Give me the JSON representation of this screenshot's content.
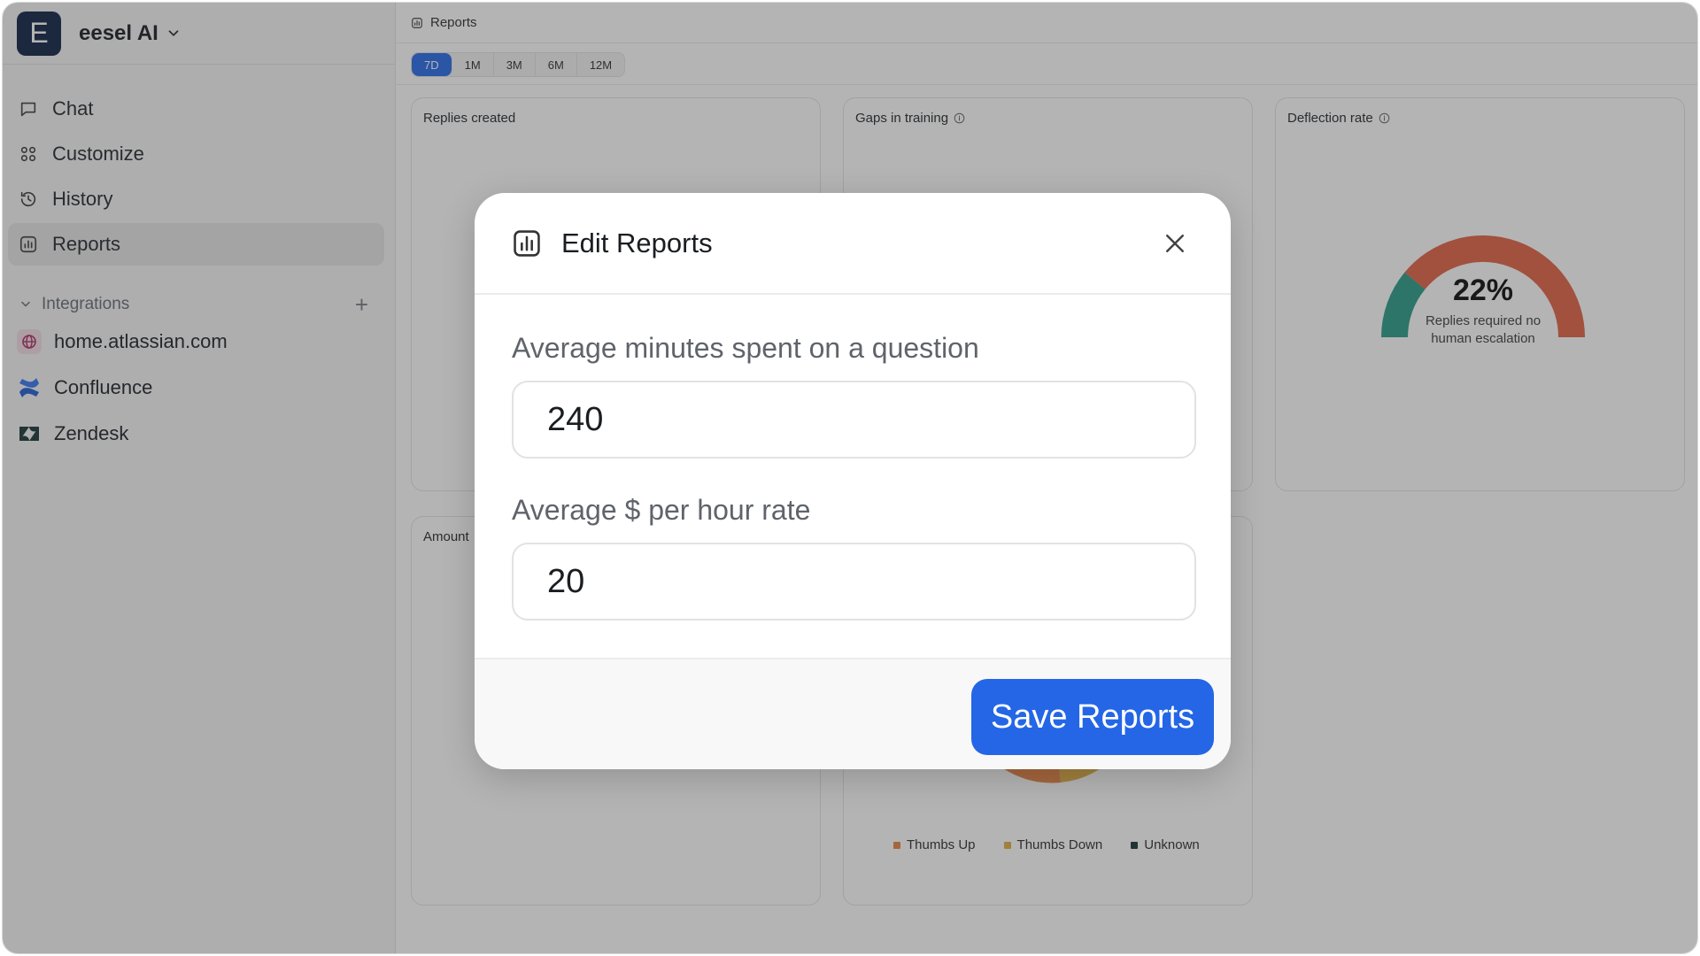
{
  "workspace": {
    "logo_letter": "E",
    "name": "eesel AI"
  },
  "nav": [
    {
      "label": "Chat",
      "icon": "chat-icon"
    },
    {
      "label": "Customize",
      "icon": "customize-icon"
    },
    {
      "label": "History",
      "icon": "history-icon"
    },
    {
      "label": "Reports",
      "icon": "reports-icon",
      "active": true
    }
  ],
  "integrations": {
    "label": "Integrations",
    "items": [
      {
        "label": "home.atlassian.com",
        "icon": "globe-icon"
      },
      {
        "label": "Confluence",
        "icon": "confluence-icon"
      },
      {
        "label": "Zendesk",
        "icon": "zendesk-icon"
      }
    ]
  },
  "breadcrumb": {
    "label": "Reports"
  },
  "ranges": [
    "7D",
    "1M",
    "3M",
    "6M",
    "12M"
  ],
  "active_range": "7D",
  "cards": {
    "replies_created": "Replies created",
    "gaps_in_training": "Gaps in training",
    "deflection_rate": "Deflection rate",
    "amount": "Amount"
  },
  "deflection": {
    "value": "22%",
    "fraction": 0.22,
    "caption_line1": "Replies required no",
    "caption_line2": "human escalation",
    "colors": {
      "deflected": "#2f9e8a",
      "escalated": "#e2684a"
    }
  },
  "legend": [
    {
      "label": "Thumbs Up",
      "color": "#e8874a"
    },
    {
      "label": "Thumbs Down",
      "color": "#e2b04a"
    },
    {
      "label": "Unknown",
      "color": "#1f3b3a"
    }
  ],
  "modal": {
    "title": "Edit Reports",
    "fields": [
      {
        "label": "Average minutes spent on a question",
        "value": "240"
      },
      {
        "label": "Average $ per hour rate",
        "value": "20"
      }
    ],
    "save_label": "Save Reports"
  },
  "colors": {
    "accent": "#2466e6",
    "logo_bg": "#14284b"
  }
}
